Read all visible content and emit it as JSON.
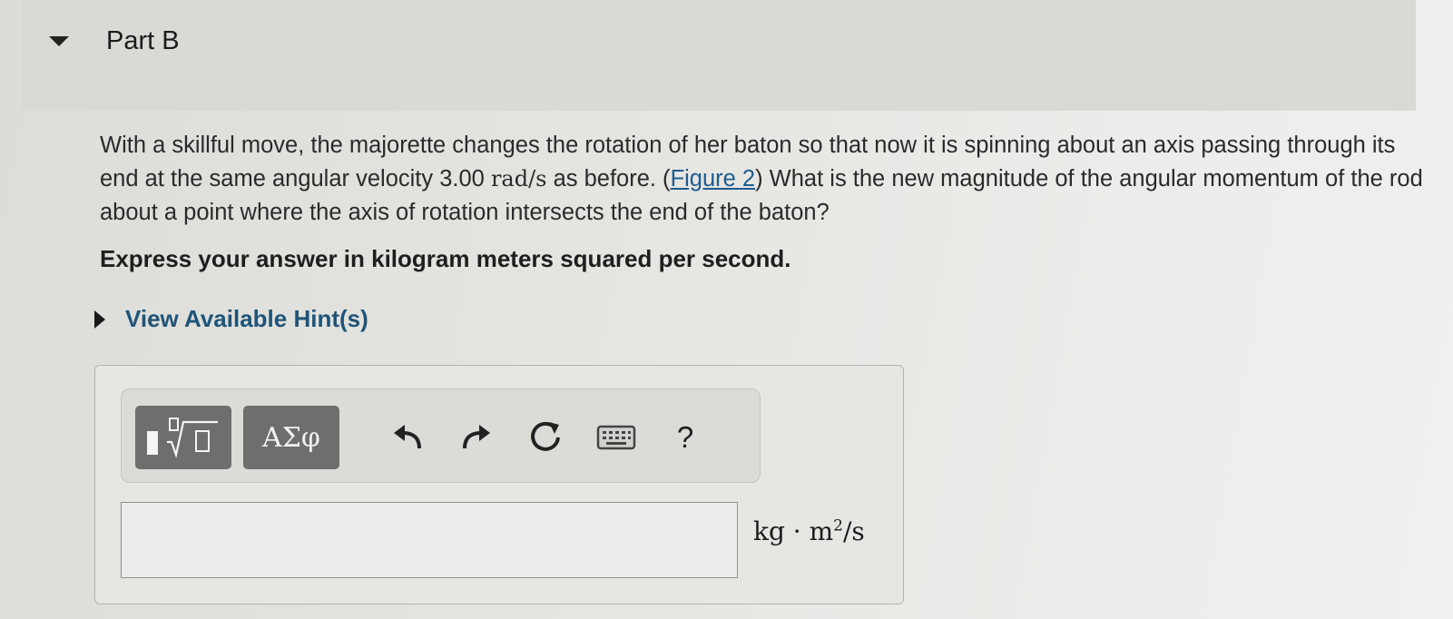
{
  "part": {
    "title": "Part B"
  },
  "question": {
    "text_before_value": "With a skillful move, the majorette changes the rotation of her baton so that now it is spinning about an axis passing through its end at the same angular velocity 3.00 ",
    "unit": "rad/s",
    "text_after_unit": " as before. (",
    "figure_link": "Figure 2",
    "text_after_link": ") What is the new magnitude of the angular momentum of the rod about a point where the axis of rotation intersects the end of the baton?"
  },
  "instruction": "Express your answer in kilogram meters squared per second.",
  "hints": {
    "label": "View Available Hint(s)"
  },
  "toolbar": {
    "templates_icon": "fraction-root-templates-icon",
    "symbols_label": "ΑΣφ",
    "undo_icon": "undo-icon",
    "redo_icon": "redo-icon",
    "reset_icon": "reset-icon",
    "keyboard_icon": "keyboard-icon",
    "help_label": "?"
  },
  "answer": {
    "value": "",
    "units_base": "kg · m",
    "units_exp": "2",
    "units_tail": "/s"
  },
  "colors": {
    "link": "#1d5b8f",
    "hint": "#1f5478",
    "tool_button": "#6e6e6c"
  }
}
